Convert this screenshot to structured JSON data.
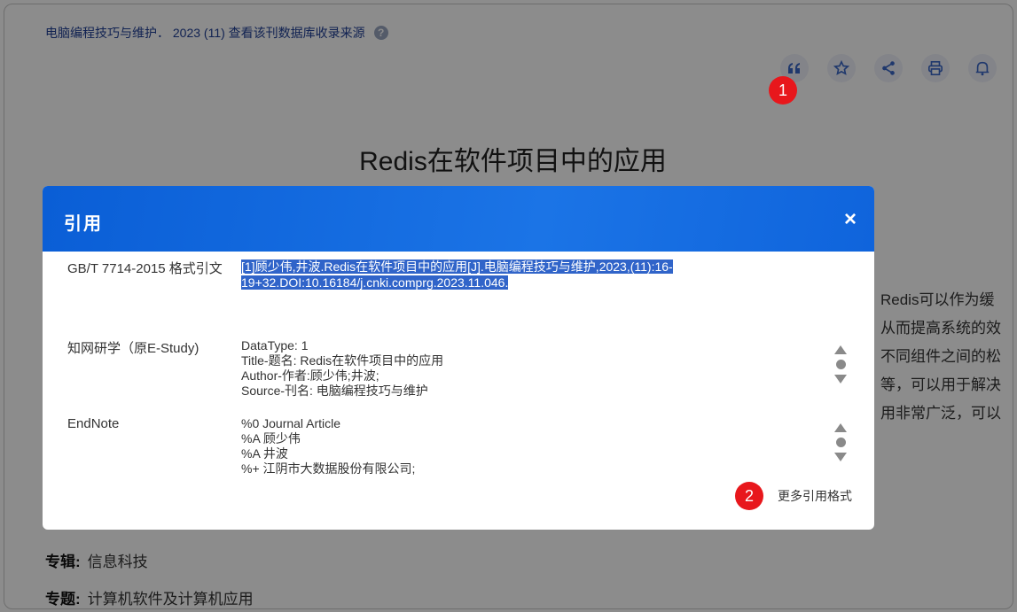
{
  "page": {
    "source_line": "电脑编程技巧与维护． 2023 (11)  查看该刊数据库收录来源",
    "help": "?",
    "article_title": "Redis在软件项目中的应用",
    "bg_text_lines": [
      "Redis可以作为缓",
      "从而提高系统的效",
      "不同组件之间的松",
      "等，可以用于解决",
      "用非常广泛，可以"
    ],
    "meta": [
      {
        "label": "专辑:",
        "value": "信息科技"
      },
      {
        "label": "专题:",
        "value": "计算机软件及计算机应用"
      }
    ]
  },
  "toolbar": {
    "icons": [
      "quote-icon",
      "star-icon",
      "share-icon",
      "print-icon",
      "bell-icon"
    ]
  },
  "badges": {
    "one": "1",
    "two": "2"
  },
  "modal": {
    "title": "引用",
    "close": "×",
    "rows": [
      {
        "label": "GB/T 7714-2015 格式引文",
        "lines": [
          "[1]顾少伟,井波.Redis在软件项目中的应用[J].电脑编程技巧与维护,2023,(11):16-",
          "19+32.DOI:10.16184/j.cnki.comprg.2023.11.046."
        ]
      },
      {
        "label": "知网研学（原E-Study)",
        "lines": [
          "DataType: 1",
          "Title-题名: Redis在软件项目中的应用",
          "Author-作者:顾少伟;井波;",
          "Source-刊名: 电脑编程技巧与维护"
        ]
      },
      {
        "label": "EndNote",
        "lines": [
          "%0 Journal Article",
          "%A 顾少伟",
          "%A 井波",
          "%+ 江阴市大数据股份有限公司;"
        ]
      }
    ],
    "more": "更多引用格式"
  }
}
